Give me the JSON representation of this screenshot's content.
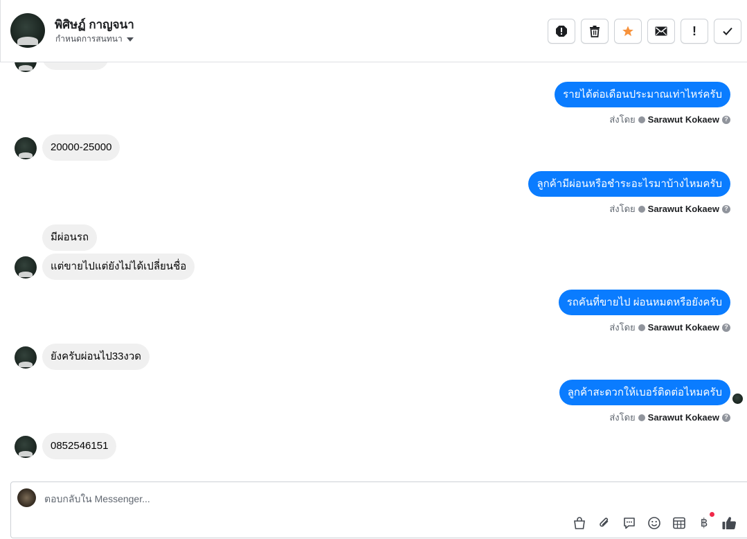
{
  "header": {
    "contact_name": "พิศิษฏ์ กาญจนา",
    "subtitle": "กำหนดการสนทนา",
    "actions": [
      {
        "name": "report-icon"
      },
      {
        "name": "trash-icon"
      },
      {
        "name": "star-icon"
      },
      {
        "name": "mail-icon"
      },
      {
        "name": "exclamation-icon",
        "label": "!"
      },
      {
        "name": "check-icon"
      }
    ]
  },
  "thread": {
    "messages": [
      {
        "dir": "out",
        "text": "รายได้ต่อเดือนประมาณเท่าไหร่ครับ",
        "sent_by_label": "ส่งโดย",
        "sender": "Sarawut Kokaew"
      },
      {
        "dir": "in",
        "text": "20000-25000"
      },
      {
        "dir": "out",
        "text": "ลูกค้ามีผ่อนหรือชำระอะไรมาบ้างไหมครับ",
        "sent_by_label": "ส่งโดย",
        "sender": "Sarawut Kokaew"
      },
      {
        "dir": "in",
        "text": "มีผ่อนรถ"
      },
      {
        "dir": "in",
        "text": "แต่ขายไปแต่ยังไม่ได้เปลี่ยนชื่อ"
      },
      {
        "dir": "out",
        "text": "รถคันที่ขายไป ผ่อนหมดหรือยังครับ",
        "sent_by_label": "ส่งโดย",
        "sender": "Sarawut Kokaew"
      },
      {
        "dir": "in",
        "text": "ยังครับผ่อนไป33งวด"
      },
      {
        "dir": "out",
        "text": "ลูกค้าสะดวกให้เบอร์ติดต่อไหมครับ",
        "sent_by_label": "ส่งโดย",
        "sender": "Sarawut Kokaew"
      },
      {
        "dir": "in",
        "text": "0852546151"
      }
    ]
  },
  "composer": {
    "placeholder": "ตอบกลับใน Messenger...",
    "value": "",
    "icons": [
      "shopping-bag-icon",
      "paperclip-icon",
      "quick-reply-icon",
      "emoji-icon",
      "table-icon",
      "baht-icon",
      "like-icon"
    ],
    "baht_glyph": "฿"
  },
  "colors": {
    "outgoing_bubble": "#0a7cff",
    "incoming_bubble": "#f0f0f0",
    "favorite_star": "#f7923b",
    "notification_dot": "#f02849"
  }
}
